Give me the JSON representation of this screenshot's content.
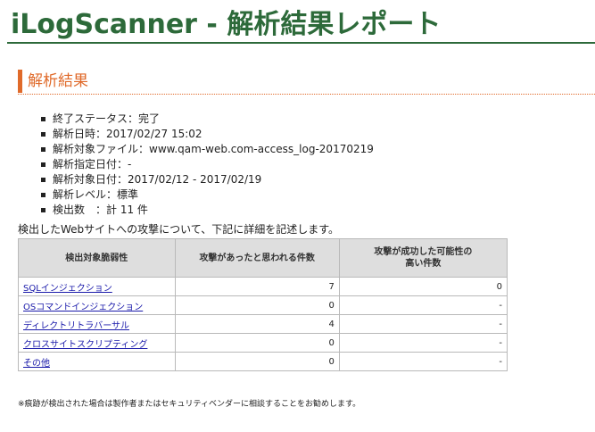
{
  "header": {
    "title": "iLogScanner - 解析結果レポート"
  },
  "section": {
    "title": "解析結果"
  },
  "summary": [
    "終了ステータス：完了",
    "解析日時：2017/02/27 15:02",
    "解析対象ファイル：www.qam-web.com-access_log-20170219",
    "解析指定日付：-",
    "解析対象日付：2017/02/12 - 2017/02/19",
    "解析レベル：標準",
    "検出数　：計 11 件"
  ],
  "intro": "検出したWebサイトへの攻撃について、下記に詳細を記述します。",
  "table": {
    "headers": [
      "検出対象脆弱性",
      "攻撃があったと思われる件数",
      "攻撃が成功した可能性の",
      "高い件数"
    ],
    "rows": [
      {
        "name": "SQLインジェクション",
        "count": "7",
        "success": "0"
      },
      {
        "name": "OSコマンドインジェクション",
        "count": "0",
        "success": "-"
      },
      {
        "name": "ディレクトリトラバーサル",
        "count": "4",
        "success": "-"
      },
      {
        "name": "クロスサイトスクリプティング",
        "count": "0",
        "success": "-"
      },
      {
        "name": "その他",
        "count": "0",
        "success": "-"
      }
    ]
  },
  "footnote": "※痕跡が検出された場合は製作者またはセキュリティベンダーに相談することをお勧めします。",
  "colors": {
    "title": "#2d6a3a",
    "accent": "#e06a2a",
    "link": "#1a1aaa",
    "header_bg": "#dedede"
  }
}
